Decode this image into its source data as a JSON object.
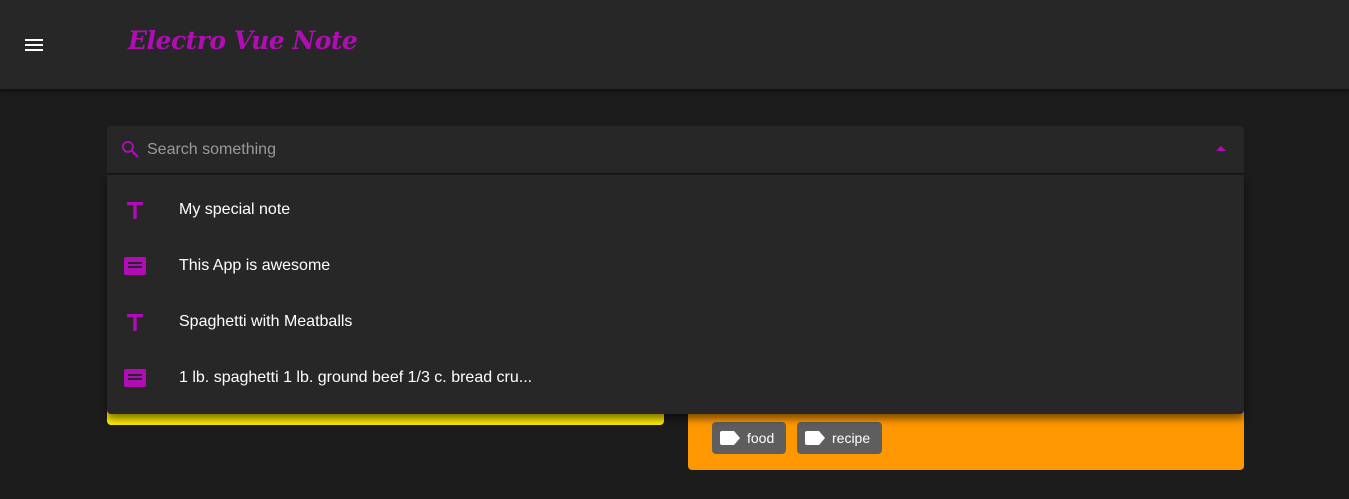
{
  "app": {
    "title": "Electro Vue Note",
    "accent_color": "#b10db6",
    "menu_icon": "menu-icon"
  },
  "search": {
    "placeholder": "Search something",
    "value": "",
    "icon": "search-icon",
    "toggle_icon": "caret-up-icon",
    "results": [
      {
        "type": "title",
        "icon": "title-icon",
        "label": "My special note"
      },
      {
        "type": "content",
        "icon": "subject-icon",
        "label": "This App is awesome"
      },
      {
        "type": "title",
        "icon": "title-icon",
        "label": "Spaghetti with Meatballs"
      },
      {
        "type": "content",
        "icon": "subject-icon",
        "label": "1 lb. spaghetti 1 lb. ground beef 1/3 c. bread cru..."
      }
    ]
  },
  "notes": [
    {
      "color": "#ffeb00",
      "tags": []
    },
    {
      "color": "#ff9800",
      "tags": [
        {
          "label": "food",
          "icon": "label-icon"
        },
        {
          "label": "recipe",
          "icon": "label-icon"
        }
      ]
    }
  ]
}
